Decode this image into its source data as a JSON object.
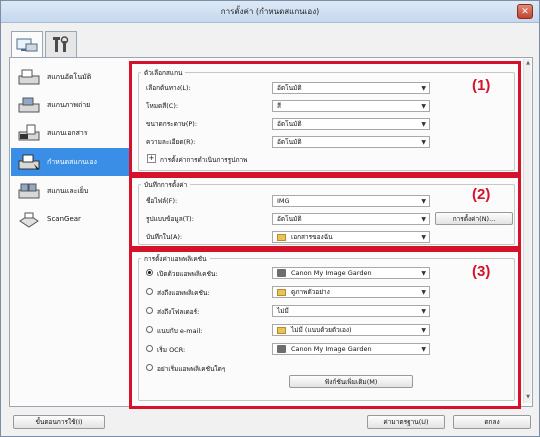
{
  "window": {
    "title": "การตั้งค่า (กำหนดสแกนเอง)",
    "close_glyph": "✕"
  },
  "sidebar": {
    "items": [
      {
        "label": "สแกนอัตโนมัติ"
      },
      {
        "label": "สแกนภาพถ่าย"
      },
      {
        "label": "สแกนเอกสาร"
      },
      {
        "label": "กำหนดสแกนเอง"
      },
      {
        "label": "สแกนและเย็บ"
      },
      {
        "label": "ScanGear"
      }
    ],
    "active_index": 3
  },
  "scan_options": {
    "title": "ตัวเลือกสแกน",
    "rows": [
      {
        "label": "เลือกต้นทาง(L):",
        "value": "อัตโนมัติ"
      },
      {
        "label": "โหมดสี(C):",
        "value": "สี"
      },
      {
        "label": "ขนาดกระดาษ(P):",
        "value": "อัตโนมัติ"
      },
      {
        "label": "ความละเอียด(R):",
        "value": "อัตโนมัติ"
      }
    ],
    "expander_glyph": "+",
    "expander_label": "การตั้งค่าการดำเนินการรูปภาพ"
  },
  "save_settings": {
    "title": "บันทึกการตั้งค่า",
    "rows": [
      {
        "label": "ชื่อไฟล์(F):",
        "value": "IMG"
      },
      {
        "label": "รูปแบบข้อมูล(T):",
        "value": "อัตโนมัติ"
      },
      {
        "label": "บันทึกใน(A):",
        "value": "เอกสารของฉัน"
      }
    ],
    "settings_button": "การตั้งค่า(N)..."
  },
  "app_settings": {
    "title": "การตั้งค่าแอพพลิเคชัน",
    "rows": [
      {
        "label": "เปิดด้วยแอพพลิเคชัน:",
        "value": "Canon My Image Garden",
        "checked": true,
        "icon": "camera-icon"
      },
      {
        "label": "ส่งถึงแอพพลิเคชัน:",
        "value": "ดูภาพตัวอย่าง",
        "checked": false,
        "icon": "folder-icon"
      },
      {
        "label": "ส่งถึงโฟลเดอร์:",
        "value": "ไม่มี",
        "checked": false,
        "icon": "none"
      },
      {
        "label": "แนบกับ e-mail:",
        "value": "ไม่มี (แนบด้วยตัวเอง)",
        "checked": false,
        "icon": "folder-icon"
      },
      {
        "label": "เริ่ม OCR:",
        "value": "Canon My Image Garden",
        "checked": false,
        "icon": "camera-icon"
      },
      {
        "label": "อย่าเริ่มแอพพลิเคชันใดๆ",
        "value": "",
        "checked": false,
        "icon": "none"
      }
    ],
    "more_functions_button": "ฟังก์ชันเพิ่มเติม(M)"
  },
  "markers": {
    "one": "(1)",
    "two": "(2)",
    "three": "(3)"
  },
  "footer": {
    "instructions_button": "ขั้นตอนการใช้(I)",
    "defaults_button": "ค่ามาตรฐาน(U)",
    "ok_button": "ตกลง"
  },
  "colors": {
    "accent": "#3a8ee6",
    "marker_red": "#d5122a"
  }
}
